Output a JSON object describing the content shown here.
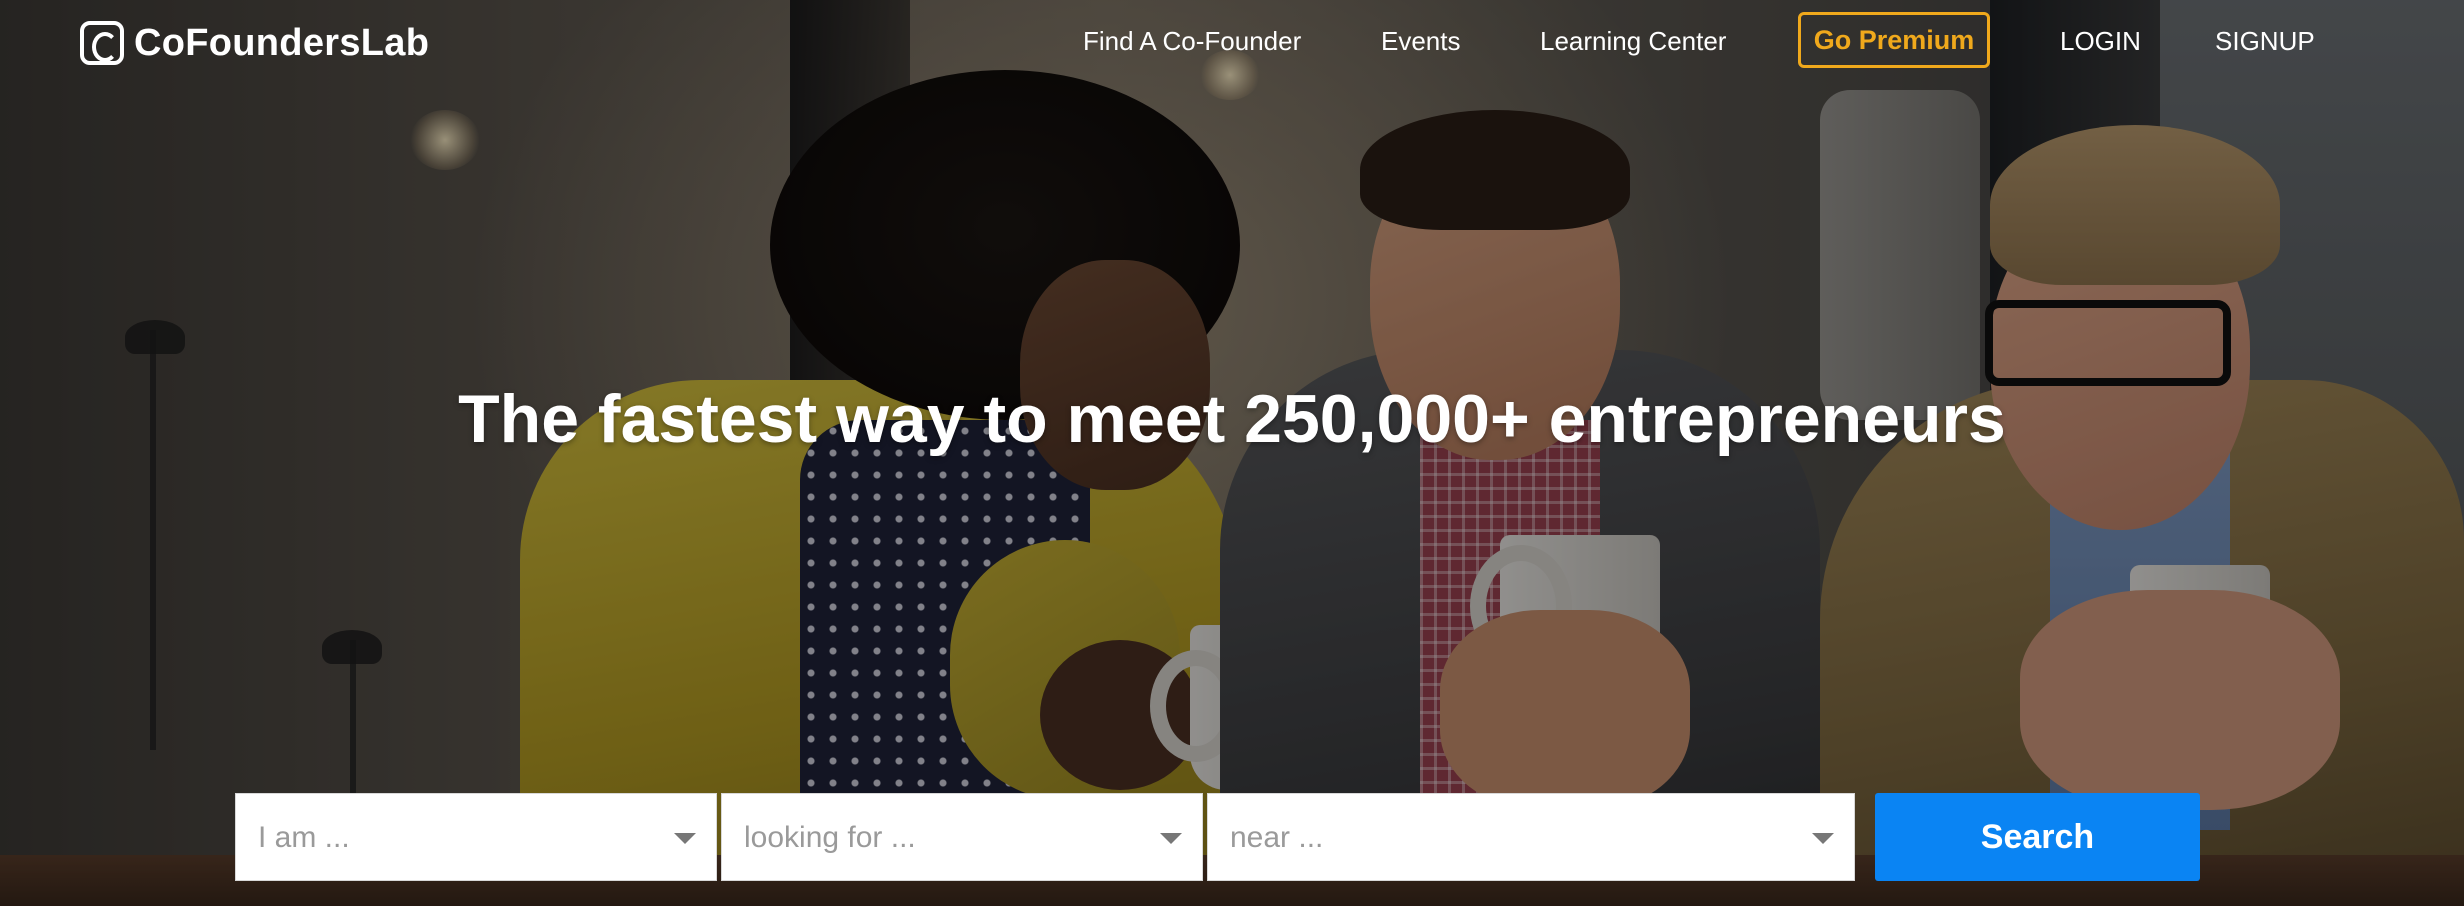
{
  "brand": {
    "name": "CoFoundersLab",
    "logo_icon": "cofounderslab-c-logo-icon"
  },
  "nav": {
    "find_cofounder": "Find A Co-Founder",
    "events": "Events",
    "learning_center": "Learning Center",
    "go_premium": "Go Premium",
    "login": "LOGIN",
    "signup": "SIGNUP"
  },
  "hero": {
    "headline": "The fastest way to meet 250,000+ entrepreneurs",
    "background": "photo-three-people-with-coffee-mugs"
  },
  "search": {
    "i_am_placeholder": "I am ...",
    "looking_for_placeholder": "looking for ...",
    "near_placeholder": "near ...",
    "button_label": "Search",
    "caret_icon": "caret-down-icon"
  },
  "colors": {
    "premium_accent": "#f0a91c",
    "search_button": "#0a84f3",
    "text_light": "#ffffff",
    "placeholder": "#9a9a9a"
  }
}
